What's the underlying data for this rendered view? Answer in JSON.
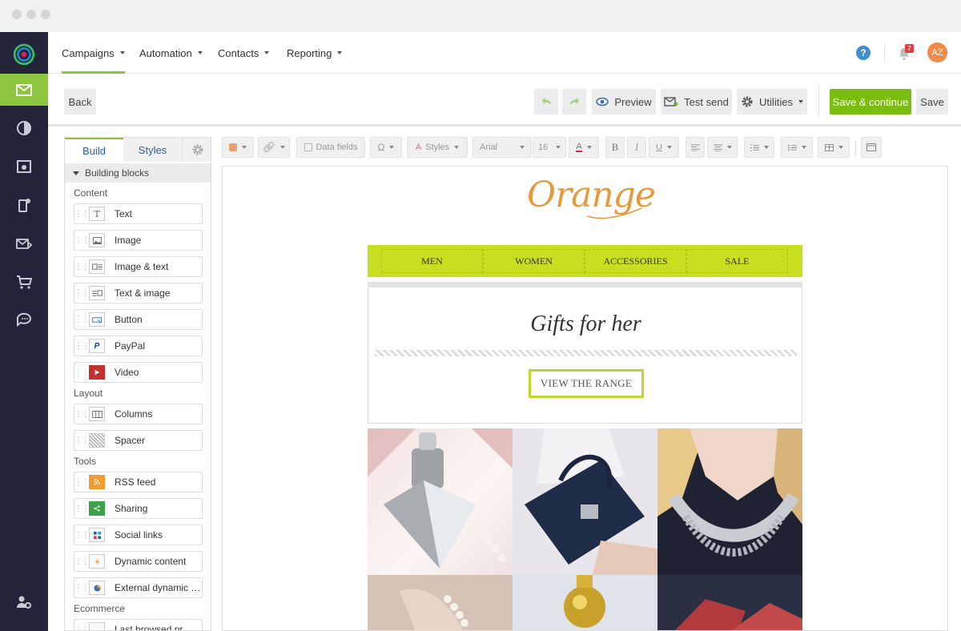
{
  "nav": {
    "items": [
      {
        "label": "Campaigns"
      },
      {
        "label": "Automation"
      },
      {
        "label": "Contacts"
      },
      {
        "label": "Reporting"
      }
    ],
    "notification_count": "7",
    "avatar_initials": "AZ"
  },
  "toolbar": {
    "back_label": "Back",
    "preview_label": "Preview",
    "test_send_label": "Test send",
    "utilities_label": "Utilities",
    "save_continue_label": "Save & continue",
    "save_label": "Save"
  },
  "panel": {
    "tabs": [
      {
        "label": "Build"
      },
      {
        "label": "Styles"
      }
    ],
    "section_title": "Building blocks",
    "categories": {
      "content": "Content",
      "layout": "Layout",
      "tools": "Tools",
      "ecommerce": "Ecommerce"
    },
    "blocks": [
      {
        "label": "Text",
        "icon": "text-icon"
      },
      {
        "label": "Image",
        "icon": "image-icon"
      },
      {
        "label": "Image & text",
        "icon": "image-text-icon"
      },
      {
        "label": "Text & image",
        "icon": "text-image-icon"
      },
      {
        "label": "Button",
        "icon": "button-icon"
      },
      {
        "label": "PayPal",
        "icon": "paypal-icon"
      },
      {
        "label": "Video",
        "icon": "video-icon"
      },
      {
        "label": "Columns",
        "icon": "columns-icon"
      },
      {
        "label": "Spacer",
        "icon": "spacer-icon"
      },
      {
        "label": "RSS feed",
        "icon": "rss-icon"
      },
      {
        "label": "Sharing",
        "icon": "sharing-icon"
      },
      {
        "label": "Social links",
        "icon": "social-links-icon"
      },
      {
        "label": "Dynamic content",
        "icon": "dynamic-content-icon"
      },
      {
        "label": "External dynamic content",
        "icon": "external-dynamic-icon"
      },
      {
        "label": "Last browsed pr",
        "icon": "last-browsed-icon"
      }
    ]
  },
  "editor_toolbar": {
    "data_fields": "Data fields",
    "styles": "Styles",
    "font": "Arial",
    "font_size": "16"
  },
  "email": {
    "logo_text": "Orange",
    "menu": [
      "MEN",
      "WOMEN",
      "ACCESSORIES",
      "SALE"
    ],
    "hero_title": "Gifts for her",
    "cta_label": "VIEW THE RANGE"
  },
  "colors": {
    "accent_green": "#8cc63f",
    "primary_button": "#7cbd12",
    "rail_bg": "#22243a",
    "email_menu_bg": "#c7df1f",
    "logo_orange": "#e59a3d",
    "avatar_bg": "#f08c4a"
  }
}
